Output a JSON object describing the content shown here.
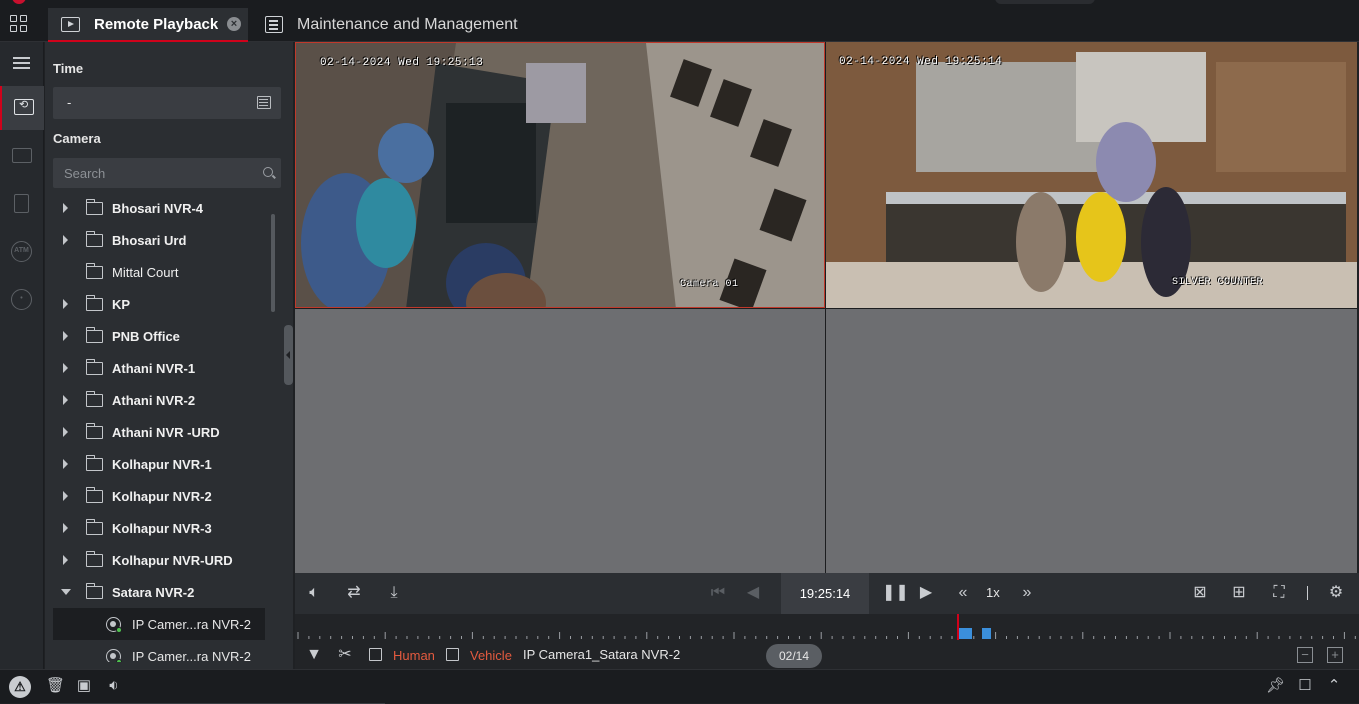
{
  "tabs": {
    "active_label": "Remote Playback",
    "other_label": "Maintenance and Management",
    "close_symbol": "×"
  },
  "panel": {
    "time_title": "Time",
    "time_value": "-",
    "camera_title": "Camera",
    "search_placeholder": "Search"
  },
  "tree": [
    {
      "name": "Bhosari NVR-4",
      "expandable": true
    },
    {
      "name": "Bhosari Urd",
      "expandable": true
    },
    {
      "name": "Mittal Court",
      "expandable": false
    },
    {
      "name": "KP",
      "expandable": true
    },
    {
      "name": "PNB Office",
      "expandable": true
    },
    {
      "name": "Athani NVR-1",
      "expandable": true
    },
    {
      "name": "Athani NVR-2",
      "expandable": true
    },
    {
      "name": "Athani NVR -URD",
      "expandable": true
    },
    {
      "name": "Kolhapur NVR-1",
      "expandable": true
    },
    {
      "name": "Kolhapur NVR-2",
      "expandable": true
    },
    {
      "name": "Kolhapur NVR-3",
      "expandable": true
    },
    {
      "name": "Kolhapur NVR-URD",
      "expandable": true
    },
    {
      "name": "Satara NVR-2",
      "expandable": true,
      "expanded": true
    }
  ],
  "cameras": [
    {
      "name": "IP Camer...ra NVR-2",
      "selected": true
    },
    {
      "name": "IP Camer...ra NVR-2",
      "selected": false
    }
  ],
  "video": {
    "tile1_osd": "02-14-2024 Wed 19:25:13",
    "tile1_cam": "Camera 01",
    "tile2_osd": "02-14-2024 Wed 19:25:14",
    "tile2_label": "SILVER COUNTER"
  },
  "controls": {
    "time": "19:25:14",
    "speed": "1x"
  },
  "timeline": {
    "filter_human": "Human",
    "filter_vehicle": "Vehicle",
    "camera_label": "IP Camera1_Satara NVR-2",
    "date": "02/14",
    "zoom_out": "−",
    "zoom_in": "+"
  },
  "colors": {
    "accent": "#d0021b",
    "record_block": "#3b8fdb",
    "filter_text": "#e35a3f"
  }
}
